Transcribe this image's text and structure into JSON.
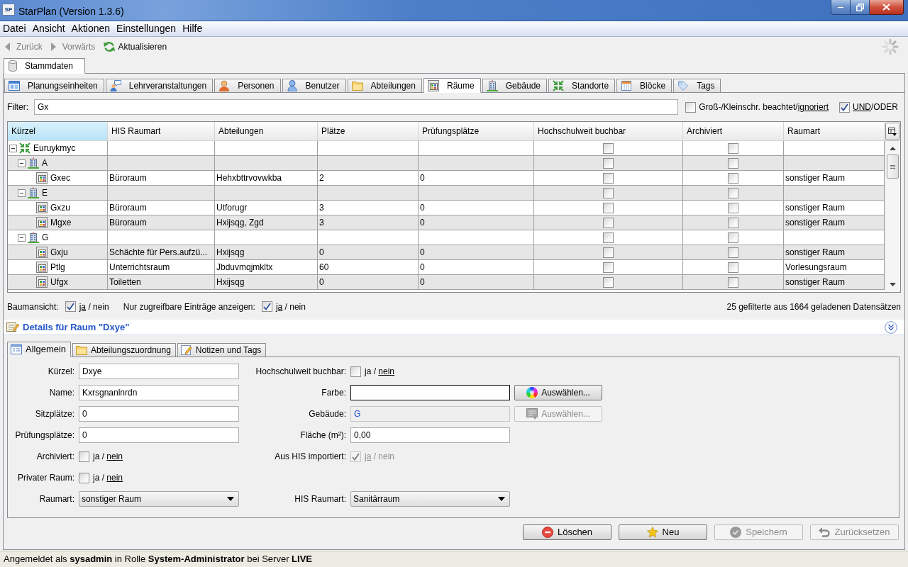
{
  "window": {
    "icon_text": "SP",
    "title": "StarPlan (Version 1.3.6)"
  },
  "menu": [
    {
      "label": "Datei"
    },
    {
      "label": "Ansicht"
    },
    {
      "label": "Aktionen"
    },
    {
      "label": "Einstellungen"
    },
    {
      "label": "Hilfe"
    }
  ],
  "toolbar": [
    {
      "kind": "back",
      "label": "Zurück",
      "disabled": true
    },
    {
      "kind": "forward",
      "label": "Vorwärts",
      "disabled": true
    },
    {
      "kind": "refresh",
      "label": "Aktualisieren",
      "disabled": false
    }
  ],
  "main_tabs": [
    {
      "label": "Stammdaten",
      "selected": true
    }
  ],
  "sub_tabs": [
    {
      "kind": "units",
      "label": "Planungseinheiten",
      "selected": false
    },
    {
      "kind": "courses",
      "label": "Lehrveranstaltungen",
      "selected": false
    },
    {
      "kind": "persons",
      "label": "Personen",
      "selected": false
    },
    {
      "kind": "users",
      "label": "Benutzer",
      "selected": false
    },
    {
      "kind": "departments",
      "label": "Abteilungen",
      "selected": false
    },
    {
      "kind": "rooms",
      "label": "Räume",
      "selected": true
    },
    {
      "kind": "buildings",
      "label": "Gebäude",
      "selected": false
    },
    {
      "kind": "sites",
      "label": "Standorte",
      "selected": false
    },
    {
      "kind": "blocks",
      "label": "Blöcke",
      "selected": false
    },
    {
      "kind": "tags",
      "label": "Tags",
      "selected": false
    }
  ],
  "filter": {
    "label": "Filter:",
    "value": "Gx",
    "toggles": [
      {
        "label": "Groß-/Kleinschr.",
        "options": [
          "beachtet",
          "ignoriert"
        ],
        "separator": "/",
        "checked": false
      },
      {
        "options": [
          "UND",
          "ODER"
        ],
        "separator": "/",
        "checked": true
      }
    ]
  },
  "table": {
    "columns": [
      {
        "label": "Kürzel",
        "selected": true
      },
      {
        "label": "HIS Raumart",
        "selected": false
      },
      {
        "label": "Abteilungen",
        "selected": false
      },
      {
        "label": "Plätze",
        "selected": false
      },
      {
        "label": "Prüfungsplätze",
        "selected": false
      },
      {
        "label": "Hochschulweit buchbar",
        "selected": false
      },
      {
        "label": "Archiviert",
        "selected": false
      },
      {
        "label": "Raumart",
        "selected": false
      }
    ],
    "rows": [
      {
        "kind": "site",
        "code": "Euruykmyc",
        "expanded": true,
        "bookable": false,
        "archived": false,
        "children": [
          {
            "kind": "building",
            "code": "A",
            "expanded": true,
            "bookable": false,
            "archived": false,
            "children": [
              {
                "kind": "room",
                "code": "Gxec",
                "his_type": "Büroraum",
                "departments": "Hehxbttrvovwkba",
                "seats": "2",
                "exam_seats": "0",
                "bookable": false,
                "archived": false,
                "room_type": "sonstiger Raum"
              }
            ]
          },
          {
            "kind": "building",
            "code": "E",
            "expanded": true,
            "bookable": false,
            "archived": false,
            "children": [
              {
                "kind": "room",
                "code": "Gxzu",
                "his_type": "Büroraum",
                "departments": "Utforugr",
                "seats": "3",
                "exam_seats": "0",
                "bookable": false,
                "archived": false,
                "room_type": "sonstiger Raum"
              },
              {
                "kind": "room",
                "code": "Mgxe",
                "his_type": "Büroraum",
                "departments": "Hxijsqg, Zgd",
                "seats": "3",
                "exam_seats": "0",
                "bookable": false,
                "archived": false,
                "room_type": "sonstiger Raum"
              }
            ]
          },
          {
            "kind": "building",
            "code": "G",
            "expanded": true,
            "bookable": false,
            "archived": false,
            "children": [
              {
                "kind": "room",
                "code": "Gxju",
                "his_type": "Schächte für Pers.aufzü...",
                "departments": "Hxijsqg",
                "seats": "0",
                "exam_seats": "0",
                "bookable": false,
                "archived": false,
                "room_type": "sonstiger Raum"
              },
              {
                "kind": "room",
                "code": "Ptlg",
                "his_type": "Unterrichtsraum",
                "departments": "Jbduvmqjmkltx",
                "seats": "60",
                "exam_seats": "0",
                "bookable": false,
                "archived": false,
                "room_type": "Vorlesungsraum"
              },
              {
                "kind": "room",
                "code": "Ufgx",
                "his_type": "Toiletten",
                "departments": "Hxijsqg",
                "seats": "0",
                "exam_seats": "0",
                "bookable": false,
                "archived": false,
                "room_type": "sonstiger Raum"
              }
            ]
          }
        ]
      }
    ]
  },
  "view_options": [
    {
      "label": "Baumansicht:",
      "checked": true,
      "options": [
        "ja",
        "nein"
      ],
      "separator": " / "
    },
    {
      "label": "Nur zugreifbare Einträge anzeigen:",
      "checked": true,
      "options": [
        "ja",
        "nein"
      ],
      "separator": " / "
    }
  ],
  "record_count": "25 gefilterte aus 1664 geladenen Datensätzen",
  "details": {
    "title": "Details für Raum \"Dxye\"",
    "tabs": [
      {
        "kind": "general",
        "label": "Allgemein",
        "selected": true
      },
      {
        "kind": "departments",
        "label": "Abteilungszuordnung",
        "selected": false
      },
      {
        "kind": "notes",
        "label": "Notizen und Tags",
        "selected": false
      }
    ],
    "form": [
      {
        "left": {
          "kind": "text",
          "label": "Kürzel:",
          "value": "Dxye"
        },
        "right": {
          "kind": "checkbox",
          "label": "Hochschulweit buchbar:",
          "checked": false,
          "options": [
            "ja",
            "nein"
          ],
          "separator": " / "
        }
      },
      {
        "left": {
          "kind": "text",
          "label": "Name:",
          "value": "Kxrsgnanlnrdn"
        },
        "right": {
          "kind": "color",
          "label": "Farbe:",
          "button": {
            "kind": "color",
            "label": "Auswählen...",
            "disabled": false
          }
        }
      },
      {
        "left": {
          "kind": "text",
          "label": "Sitzplätze:",
          "value": "0"
        },
        "right": {
          "kind": "reference",
          "label": "Gebäude:",
          "value": "G",
          "disabled": true,
          "button": {
            "kind": "list",
            "label": "Auswählen...",
            "disabled": true
          }
        }
      },
      {
        "left": {
          "kind": "text",
          "label": "Prüfungsplätze:",
          "value": "0"
        },
        "right": {
          "kind": "text",
          "label": "Fläche (m²):",
          "value": "0,00"
        }
      },
      {
        "left": {
          "kind": "checkbox",
          "label": "Archiviert:",
          "checked": false,
          "options": [
            "ja",
            "nein"
          ],
          "separator": " / "
        },
        "right": {
          "kind": "checkbox",
          "label": "Aus HIS importiert:",
          "checked": true,
          "disabled": true,
          "options": [
            "ja",
            "nein"
          ],
          "separator": " / "
        }
      },
      {
        "left": {
          "kind": "checkbox",
          "label": "Privater Raum:",
          "checked": false,
          "options": [
            "ja",
            "nein"
          ],
          "separator": " / "
        }
      },
      {
        "left": {
          "kind": "select",
          "label": "Raumart:",
          "value": "sonstiger Raum"
        },
        "right": {
          "kind": "select",
          "label": "HIS Raumart:",
          "value": "Sanitärraum"
        }
      }
    ],
    "buttons": [
      {
        "kind": "delete",
        "label": "Löschen",
        "disabled": false
      },
      {
        "kind": "new",
        "label": "Neu",
        "disabled": false
      },
      {
        "kind": "save",
        "label": "Speichern",
        "disabled": true
      },
      {
        "kind": "reset",
        "label": "Zurücksetzen",
        "disabled": true
      }
    ]
  },
  "status_bar": "Angemeldet als **sysadmin** in Rolle **System-Administrator** bei Server **LIVE**"
}
